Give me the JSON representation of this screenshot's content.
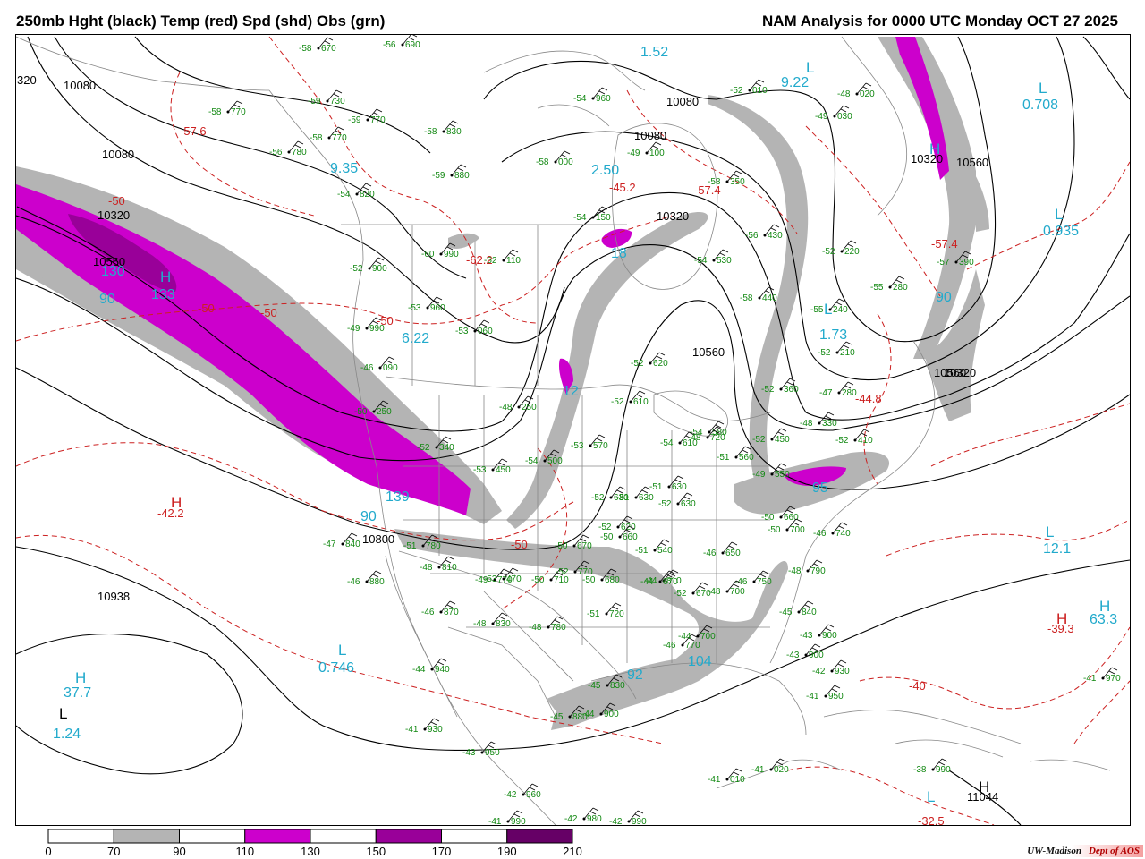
{
  "header": {
    "title": "250mb Hght (black) Temp (red) Spd (shd) Obs (grn)",
    "analysis": "NAM Analysis for 0000 UTC Monday  OCT 27 2025"
  },
  "legend": {
    "labels": [
      "0",
      "70",
      "90",
      "110",
      "130",
      "150",
      "170",
      "190",
      "210"
    ],
    "colors": [
      "#ffffff",
      "#b4b4b4",
      "#ffffff",
      "#cc00cc",
      "#ffffff",
      "#990099",
      "#ffffff",
      "#660066"
    ]
  },
  "credit": {
    "univ": "UW-Madison",
    "dept": "Dept of AOS"
  },
  "colors": {
    "height": "#000000",
    "temp": "#cc2020",
    "speed_label": "#22aacc",
    "obs": "#118811",
    "border": "#888888",
    "gray_shade": "#b4b4b4",
    "magenta": "#cc00cc",
    "purple": "#990099"
  },
  "height_labels": [
    {
      "t": "10080",
      "c": "label-10080-a"
    },
    {
      "t": "10080",
      "c": "label-10080-b"
    },
    {
      "t": "10080",
      "c": "label-10080-c"
    },
    {
      "t": "10080",
      "c": "label-10080-d"
    },
    {
      "t": "10320",
      "c": "label-10320-a"
    },
    {
      "t": "10320",
      "c": "label-10320-b"
    },
    {
      "t": "10320",
      "c": "label-10320-c"
    },
    {
      "t": "10320",
      "c": "label-10320-d"
    },
    {
      "t": "10560",
      "c": "label-10560-a"
    },
    {
      "t": "10560",
      "c": "label-10560-b"
    },
    {
      "t": "10560",
      "c": "label-10560-c"
    },
    {
      "t": "10560",
      "c": "label-10560-d"
    },
    {
      "t": "10800",
      "c": "label-10800"
    },
    {
      "t": "10938",
      "c": "label-10938"
    },
    {
      "t": "11044",
      "c": "label-11044"
    },
    {
      "t": "320",
      "c": "label-320"
    }
  ],
  "temp_labels": [
    "-57.6",
    "-50",
    "-50",
    "-62.2",
    "-50",
    "-45.2",
    "-57.4",
    "-57.4",
    "-44.8",
    "-42.2",
    "-50",
    "-39.3",
    "-40",
    "-32.5",
    "-50"
  ],
  "speed_labels": [
    "1.52",
    "9.22",
    "0.708",
    "9.35",
    "2.50",
    "0.935",
    "130",
    "90",
    "133",
    "6.22",
    "18",
    "12",
    "1.73",
    "90",
    "139",
    "90",
    "0.746",
    "37.7",
    "12.1",
    "63.3",
    "104",
    "92",
    "95",
    "1.24"
  ],
  "centers": [
    "H",
    "H",
    "L",
    "L",
    "L",
    "L",
    "H",
    "L",
    "H",
    "L",
    "H",
    "H",
    "L",
    "H",
    "L"
  ],
  "obs": [
    {
      "t": "-58",
      "v": "670"
    },
    {
      "t": "-56",
      "v": "690"
    },
    {
      "t": "-59",
      "v": "730"
    },
    {
      "t": "-58",
      "v": "770"
    },
    {
      "t": "-59",
      "v": "770"
    },
    {
      "t": "-58",
      "v": "830"
    },
    {
      "t": "-58",
      "v": "770"
    },
    {
      "t": "-56",
      "v": "780"
    },
    {
      "t": "-54",
      "v": "960"
    },
    {
      "t": "-58",
      "v": "000"
    },
    {
      "t": "-49",
      "v": "100"
    },
    {
      "t": "-59",
      "v": "880"
    },
    {
      "t": "-54",
      "v": "820"
    },
    {
      "t": "-54",
      "v": "150"
    },
    {
      "t": "-60",
      "v": "990"
    },
    {
      "t": "-52",
      "v": "110"
    },
    {
      "t": "-52",
      "v": "900"
    },
    {
      "t": "-53",
      "v": "960"
    },
    {
      "t": "-49",
      "v": "990"
    },
    {
      "t": "-53",
      "v": "060"
    },
    {
      "t": "-46",
      "v": "090"
    },
    {
      "t": "-52",
      "v": "620"
    },
    {
      "t": "-52",
      "v": "610"
    },
    {
      "t": "-48",
      "v": "250"
    },
    {
      "t": "-50",
      "v": "250"
    },
    {
      "t": "-53",
      "v": "570"
    },
    {
      "t": "-54",
      "v": "500"
    },
    {
      "t": "-53",
      "v": "450"
    },
    {
      "t": "-52",
      "v": "340"
    },
    {
      "t": "-48",
      "v": "020"
    },
    {
      "t": "-49",
      "v": "030"
    },
    {
      "t": "-52",
      "v": "010"
    },
    {
      "t": "-58",
      "v": "350"
    },
    {
      "t": "-56",
      "v": "430"
    },
    {
      "t": "-52",
      "v": "220"
    },
    {
      "t": "-57",
      "v": "390"
    },
    {
      "t": "-55",
      "v": "280"
    },
    {
      "t": "-55",
      "v": "240"
    },
    {
      "t": "-58",
      "v": "440"
    },
    {
      "t": "-54",
      "v": "530"
    },
    {
      "t": "-52",
      "v": "210"
    },
    {
      "t": "-52",
      "v": "360"
    },
    {
      "t": "-47",
      "v": "280"
    },
    {
      "t": "-48",
      "v": "330"
    },
    {
      "t": "-52",
      "v": "410"
    },
    {
      "t": "-52",
      "v": "450"
    },
    {
      "t": "-49",
      "v": "550"
    },
    {
      "t": "-51",
      "v": "560"
    },
    {
      "t": "-54",
      "v": "580"
    },
    {
      "t": "-54",
      "v": "610"
    },
    {
      "t": "-52",
      "v": "630"
    },
    {
      "t": "-51",
      "v": "630"
    },
    {
      "t": "-52",
      "v": "630"
    },
    {
      "t": "-51",
      "v": "630"
    },
    {
      "t": "-52",
      "v": "620"
    },
    {
      "t": "-50",
      "v": "660"
    },
    {
      "t": "-50",
      "v": "670"
    },
    {
      "t": "-50",
      "v": "700"
    },
    {
      "t": "-46",
      "v": "740"
    },
    {
      "t": "-46",
      "v": "750"
    },
    {
      "t": "-48",
      "v": "790"
    },
    {
      "t": "-45",
      "v": "840"
    },
    {
      "t": "-43",
      "v": "900"
    },
    {
      "t": "-43",
      "v": "900"
    },
    {
      "t": "-42",
      "v": "930"
    },
    {
      "t": "-41",
      "v": "950"
    },
    {
      "t": "-41",
      "v": "970"
    },
    {
      "t": "-47",
      "v": "840"
    },
    {
      "t": "-51",
      "v": "780"
    },
    {
      "t": "-48",
      "v": "810"
    },
    {
      "t": "-46",
      "v": "880"
    },
    {
      "t": "-49",
      "v": "770"
    },
    {
      "t": "-50",
      "v": "710"
    },
    {
      "t": "-50",
      "v": "680"
    },
    {
      "t": "-46",
      "v": "870"
    },
    {
      "t": "-48",
      "v": "830"
    },
    {
      "t": "-48",
      "v": "780"
    },
    {
      "t": "-51",
      "v": "720"
    },
    {
      "t": "-46",
      "v": "770"
    },
    {
      "t": "-48",
      "v": "700"
    },
    {
      "t": "-44",
      "v": "700"
    },
    {
      "t": "-44",
      "v": "810"
    },
    {
      "t": "-45",
      "v": "830"
    },
    {
      "t": "-45",
      "v": "880"
    },
    {
      "t": "-44",
      "v": "900"
    },
    {
      "t": "-44",
      "v": "940"
    },
    {
      "t": "-41",
      "v": "930"
    },
    {
      "t": "-43",
      "v": "950"
    },
    {
      "t": "-42",
      "v": "960"
    },
    {
      "t": "-41",
      "v": "990"
    },
    {
      "t": "-42",
      "v": "980"
    },
    {
      "t": "-42",
      "v": "990"
    },
    {
      "t": "-41",
      "v": "010"
    },
    {
      "t": "-41",
      "v": "020"
    },
    {
      "t": "-38",
      "v": "990"
    },
    {
      "t": "-50",
      "v": "660"
    },
    {
      "t": "-51",
      "v": "540"
    },
    {
      "t": "-44",
      "v": "670"
    },
    {
      "t": "-46",
      "v": "650"
    },
    {
      "t": "-48",
      "v": "720"
    },
    {
      "t": "-53",
      "v": "470"
    },
    {
      "t": "-52",
      "v": "770"
    },
    {
      "t": "-52",
      "v": "670"
    },
    {
      "t": "-48",
      "v": "700"
    },
    {
      "t": "-58",
      "v": "830"
    }
  ]
}
